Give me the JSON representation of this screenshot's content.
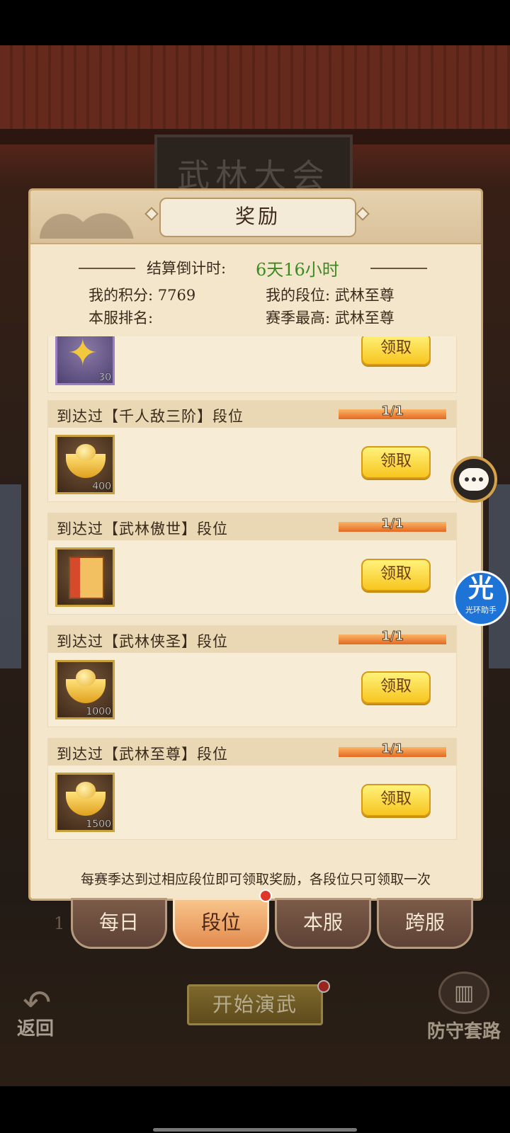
{
  "scene": {
    "sign_text": "武林大会",
    "info_icon": "info-icon",
    "menu_label": "跨服",
    "back_label": "返回",
    "start_label": "开始演武",
    "defense_label": "防守套路",
    "rank_num": "1"
  },
  "helper": {
    "glyph": "光",
    "label": "光环助手"
  },
  "panel": {
    "title": "奖励",
    "countdown_label": "结算倒计时:",
    "countdown_value": "6天16小时",
    "my_score": "我的积分: 7769",
    "my_rank_level": "我的段位: 武林至尊",
    "server_rank": "本服排名:",
    "season_best": "赛季最高: 武林至尊",
    "footnote": "每赛季达到过相应段位即可领取奖励，各段位只可领取一次"
  },
  "rewards": [
    {
      "title": "",
      "progress": "",
      "item": "star-shard",
      "count": "30",
      "button": "领取"
    },
    {
      "title": "到达过【千人敌三阶】段位",
      "progress": "1/1",
      "item": "gold-ingot",
      "count": "400",
      "button": "领取"
    },
    {
      "title": "到达过【武林傲世】段位",
      "progress": "1/1",
      "item": "treasure-chest",
      "count": "",
      "button": "领取"
    },
    {
      "title": "到达过【武林侠圣】段位",
      "progress": "1/1",
      "item": "gold-ingot",
      "count": "1000",
      "button": "领取"
    },
    {
      "title": "到达过【武林至尊】段位",
      "progress": "1/1",
      "item": "gold-ingot",
      "count": "1500",
      "button": "领取"
    }
  ],
  "tabs": [
    {
      "label": "每日"
    },
    {
      "label": "段位",
      "active": true
    },
    {
      "label": "本服"
    },
    {
      "label": "跨服"
    }
  ],
  "colors": {
    "accent": "#3d8a22",
    "claim": "#f7c51f",
    "progress": "#e46a22"
  }
}
